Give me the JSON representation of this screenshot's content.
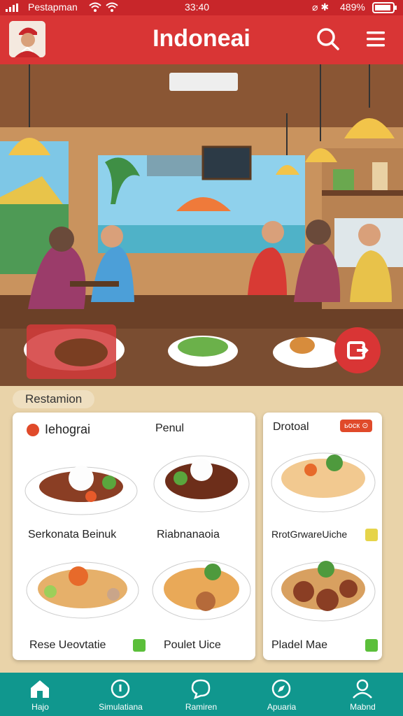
{
  "status_bar": {
    "carrier": "Pestapman",
    "time": "33:40",
    "battery": "489%"
  },
  "header": {
    "title": "Indoneai"
  },
  "section": {
    "label": "Restamion"
  },
  "menu": {
    "left_card": {
      "col1_header": "Iehograi",
      "col2_header": "Penul",
      "items": [
        "Serkonata Beinuk",
        "Riabnanaoia",
        "Rese Ueovtatie",
        "Poulet Uice"
      ]
    },
    "right_card": {
      "header": "Drotoal",
      "badge": "ьоск ⊙",
      "items": [
        "RrotGrwareUiche",
        "Pladel Mae"
      ]
    }
  },
  "nav": {
    "items": [
      {
        "label": "Hajo",
        "icon": "home-icon"
      },
      {
        "label": "Simulatiana",
        "icon": "info-icon"
      },
      {
        "label": "Ramiren",
        "icon": "chat-icon"
      },
      {
        "label": "Apuaria",
        "icon": "compass-icon"
      },
      {
        "label": "Mabnd",
        "icon": "user-icon"
      }
    ]
  },
  "colors": {
    "header": "#d93535",
    "nav": "#10978e",
    "check": "#5bbf3a",
    "badge": "#e04a2a"
  }
}
